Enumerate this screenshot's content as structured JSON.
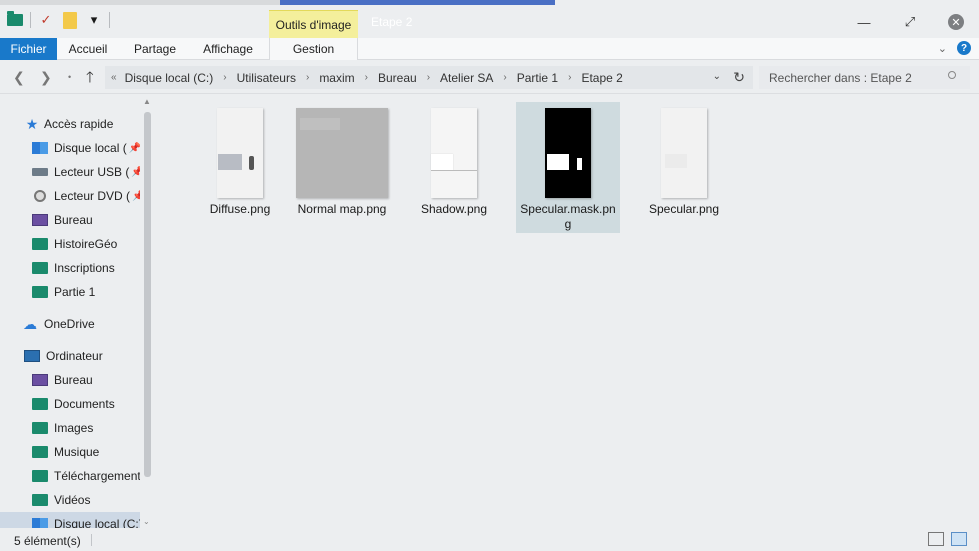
{
  "window": {
    "title": "Etape 2",
    "contextual_tab_group": "Outils d'image"
  },
  "ribbon": {
    "tabs": [
      "Fichier",
      "Accueil",
      "Partage",
      "Affichage",
      "Gestion"
    ]
  },
  "address": {
    "crumbs": [
      "Disque local (C:)",
      "Utilisateurs",
      "maxim",
      "Bureau",
      "Atelier SA",
      "Partie 1",
      "Etape 2"
    ],
    "search_placeholder": "Rechercher dans : Etape 2"
  },
  "sidebar": {
    "items": [
      {
        "label": "Accès rapide",
        "icon": "star-icon"
      },
      {
        "label": "Disque local (",
        "icon": "windows-drive-icon",
        "pinned": true
      },
      {
        "label": "Lecteur USB (",
        "icon": "usb-drive-icon",
        "pinned": true
      },
      {
        "label": "Lecteur DVD (",
        "icon": "dvd-drive-icon",
        "pinned": true
      },
      {
        "label": "Bureau",
        "icon": "desktop-icon"
      },
      {
        "label": "HistoireGéo",
        "icon": "folder-icon"
      },
      {
        "label": "Inscriptions",
        "icon": "folder-icon"
      },
      {
        "label": "Partie 1",
        "icon": "folder-icon"
      },
      {
        "label": "OneDrive",
        "icon": "cloud-icon"
      },
      {
        "label": "Ordinateur",
        "icon": "computer-icon"
      },
      {
        "label": "Bureau",
        "icon": "desktop-icon"
      },
      {
        "label": "Documents",
        "icon": "folder-icon"
      },
      {
        "label": "Images",
        "icon": "folder-icon"
      },
      {
        "label": "Musique",
        "icon": "folder-icon"
      },
      {
        "label": "Téléchargement",
        "icon": "folder-icon"
      },
      {
        "label": "Vidéos",
        "icon": "folder-icon"
      },
      {
        "label": "Disque local (C:)",
        "icon": "windows-drive-icon"
      }
    ]
  },
  "files": [
    {
      "name": "Diffuse.png"
    },
    {
      "name": "Normal map.png"
    },
    {
      "name": "Shadow.png"
    },
    {
      "name": "Specular.mask.png",
      "selected": true
    },
    {
      "name": "Specular.png"
    }
  ],
  "status": {
    "count": "5 élément(s)"
  }
}
